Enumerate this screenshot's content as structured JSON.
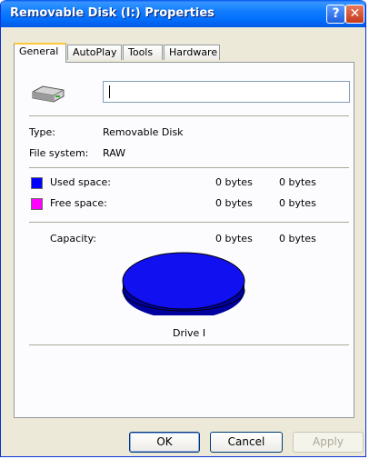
{
  "window": {
    "title": "Removable Disk (I:) Properties"
  },
  "titlebar": {
    "help_glyph": "?",
    "close_glyph": "✕"
  },
  "tabs": [
    {
      "label": "General",
      "active": true
    },
    {
      "label": "AutoPlay",
      "active": false
    },
    {
      "label": "Tools",
      "active": false
    },
    {
      "label": "Hardware",
      "active": false
    }
  ],
  "general": {
    "drive_name_value": "",
    "type_label": "Type:",
    "type_value": "Removable Disk",
    "fs_label": "File system:",
    "fs_value": "RAW",
    "used_label": "Used space:",
    "used_bytes": "0 bytes",
    "used_size": "0 bytes",
    "free_label": "Free space:",
    "free_bytes": "0 bytes",
    "free_size": "0 bytes",
    "capacity_label": "Capacity:",
    "capacity_bytes": "0 bytes",
    "capacity_size": "0 bytes",
    "drive_label": "Drive I"
  },
  "colors": {
    "used": "#0000ff",
    "free": "#ff00ff",
    "pie_top": "#1010f0",
    "pie_side": "#0000a0"
  },
  "buttons": {
    "ok": "OK",
    "cancel": "Cancel",
    "apply": "Apply"
  },
  "icons": {
    "drive": "removable-drive-icon",
    "help": "help-icon",
    "close": "close-icon"
  }
}
